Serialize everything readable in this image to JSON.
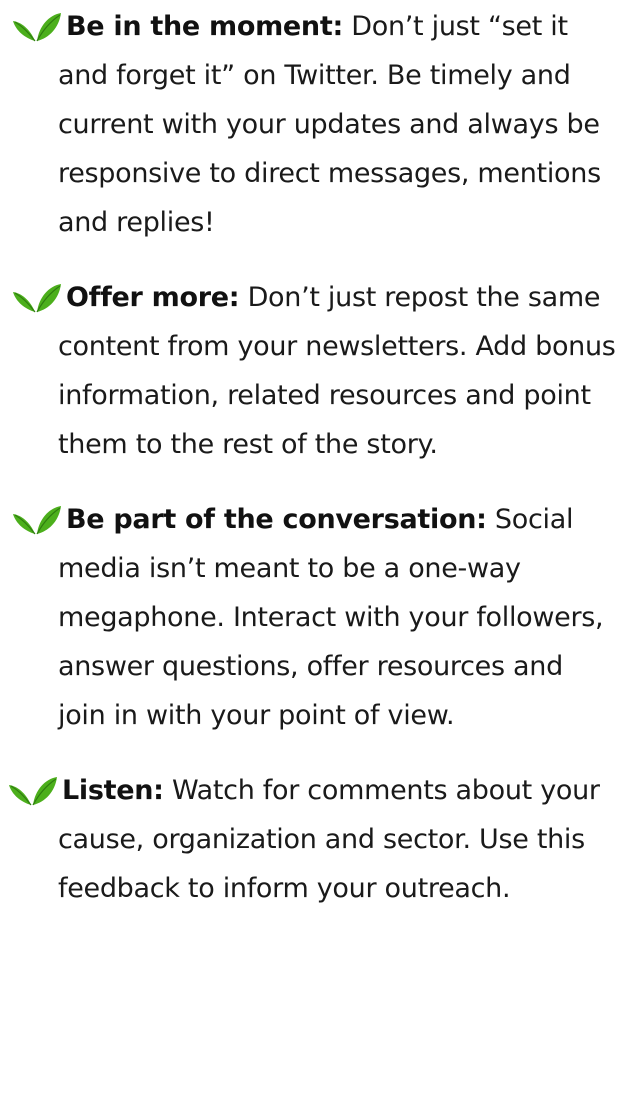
{
  "accent_color": "#4caf1c",
  "bullet_icon": "sprout-icon",
  "tips": [
    {
      "title": "Be in the moment:",
      "body": " Don’t just “set it and forget it” on Twitter. Be timely and current with your updates and always be responsive to direct messages, mentions and replies!"
    },
    {
      "title": "Offer more:",
      "body": " Don’t just repost the same content from your newsletters. Add bonus information, related resources and point them to the rest of the story."
    },
    {
      "title": "Be part of the conversation:",
      "body": " Social media isn’t meant to be a one-way megaphone. Interact with your followers, answer questions, offer resources and join in with your point of view."
    },
    {
      "title": "Listen:",
      "body": " Watch for comments about your cause, organization and sector. Use this feedback to inform your outreach."
    }
  ]
}
